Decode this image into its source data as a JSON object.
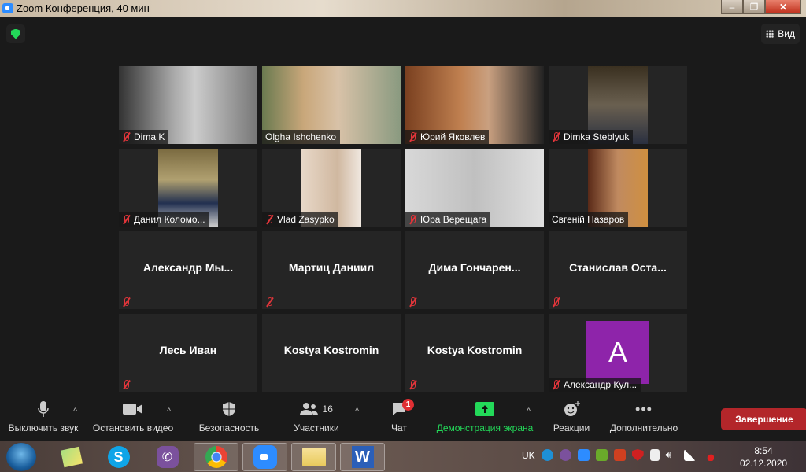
{
  "window": {
    "title": "Zoom Конференция, 40 мин",
    "minimize": "–",
    "maximize": "❐",
    "close": "✕"
  },
  "view_button": "Вид",
  "participants_tiles": [
    {
      "name": "Dima K",
      "video": true,
      "muted": true
    },
    {
      "name": "Olgha Ishchenko",
      "video": true,
      "muted": false,
      "speaking": true
    },
    {
      "name": "Юрий Яковлев",
      "video": true,
      "muted": true
    },
    {
      "name": "Dimka Steblyuk",
      "video": true,
      "muted": true
    },
    {
      "name": "Данил Коломо...",
      "video": true,
      "muted": true
    },
    {
      "name": "Vlad Zasypko",
      "video": true,
      "muted": true
    },
    {
      "name": "Юра Верещага",
      "video": true,
      "muted": true
    },
    {
      "name": "Євгеній Назаров",
      "video": true,
      "muted": false
    },
    {
      "name": "Александр  Мы...",
      "video": false,
      "muted": true
    },
    {
      "name": "Мартиц Даниил",
      "video": false,
      "muted": true
    },
    {
      "name": "Дима  Гончарен...",
      "video": false,
      "muted": true
    },
    {
      "name": "Станислав  Оста...",
      "video": false,
      "muted": true
    },
    {
      "name": "Лесь Иван",
      "video": false,
      "muted": true
    },
    {
      "name": "Kostya Kostromin",
      "video": false,
      "muted": false
    },
    {
      "name": "Kostya Kostromin",
      "video": false,
      "muted": true
    },
    {
      "name": "Александр Кул...",
      "video": false,
      "muted": true,
      "avatar_letter": "A",
      "avatar_color": "#8e24aa"
    }
  ],
  "toolbar": {
    "mute": "Выключить звук",
    "video": "Остановить видео",
    "security": "Безопасность",
    "participants": "Участники",
    "participants_count": "16",
    "chat": "Чат",
    "chat_badge": "1",
    "share": "Демонстрация экрана",
    "reactions": "Реакции",
    "more": "Дополнительно",
    "end": "Завершение"
  },
  "taskbar": {
    "lang": "UK",
    "time": "8:54",
    "date": "02.12.2020"
  },
  "colors": {
    "accent_green": "#23d959",
    "end_red": "#b3262a",
    "speaking": "#d3e95c"
  }
}
